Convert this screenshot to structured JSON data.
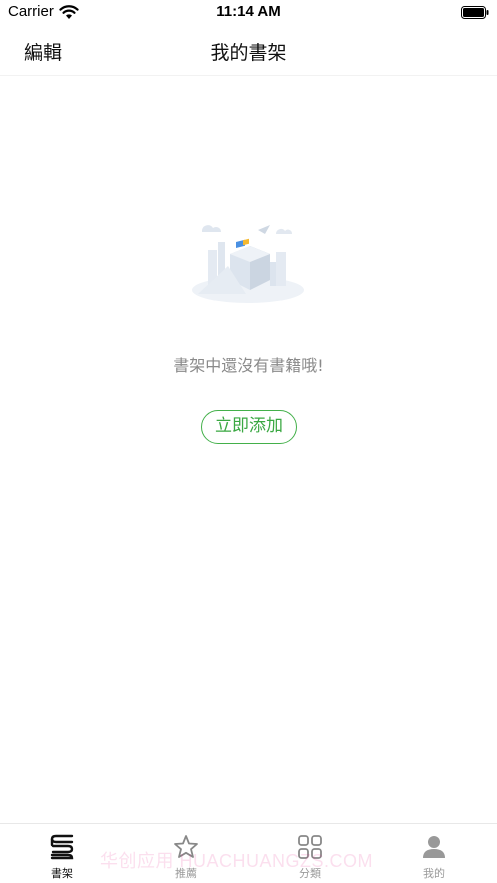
{
  "status_bar": {
    "carrier": "Carrier",
    "time": "11:14 AM"
  },
  "nav": {
    "edit_label": "編輯",
    "title": "我的書架"
  },
  "empty_state": {
    "message": "書架中還沒有書籍哦!",
    "add_button_label": "立即添加"
  },
  "tabs": [
    {
      "label": "書架",
      "icon": "bookshelf-icon",
      "active": true
    },
    {
      "label": "推薦",
      "icon": "star-icon",
      "active": false
    },
    {
      "label": "分類",
      "icon": "grid-icon",
      "active": false
    },
    {
      "label": "我的",
      "icon": "user-icon",
      "active": false
    }
  ],
  "watermark": "华创应用 HUACHUANGZS.COM",
  "colors": {
    "accent": "#43b04a",
    "muted_text": "#8a8a8a",
    "tab_active": "#111111",
    "tab_inactive": "#9a9a9a"
  }
}
